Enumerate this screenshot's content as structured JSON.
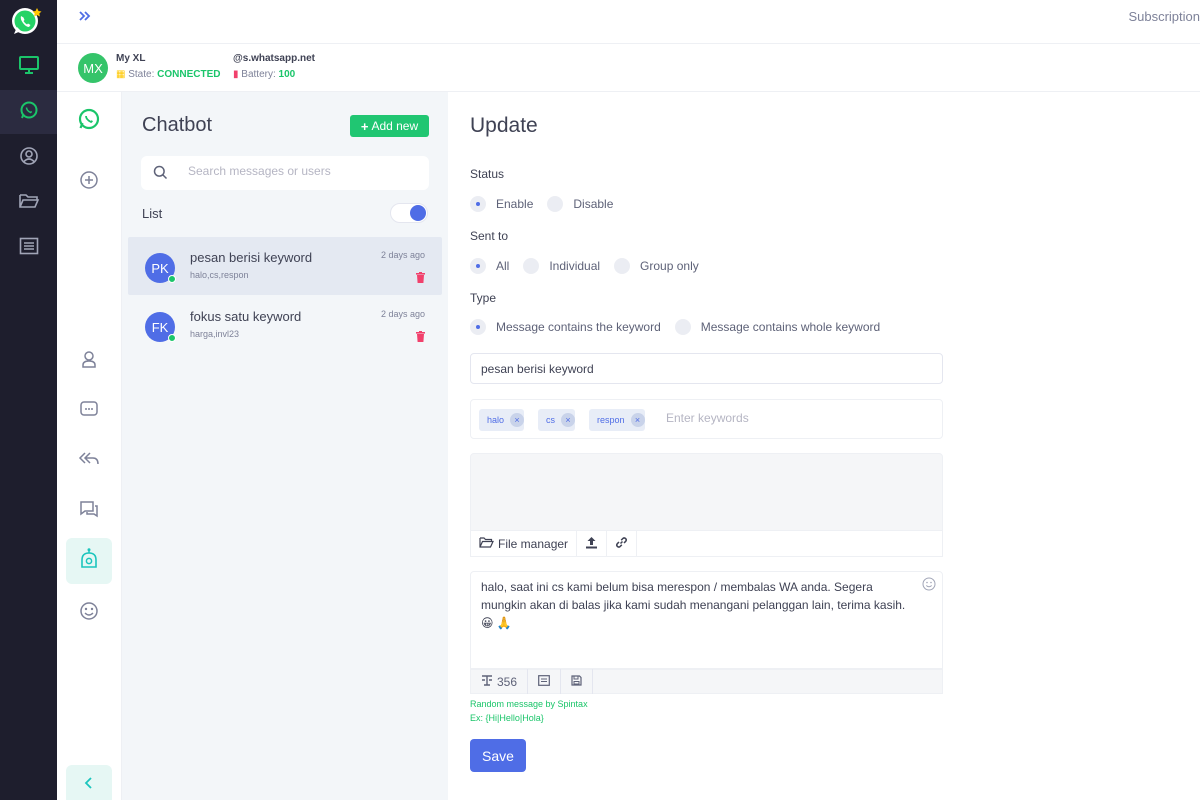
{
  "topbar": {
    "subscription": "Subscription"
  },
  "account": {
    "initials": "MX",
    "name": "My XL",
    "state_label": "State:",
    "state_value": "CONNECTED",
    "number": "@s.whatsapp.net",
    "battery_label": "Battery:",
    "battery_value": "100"
  },
  "rail": {
    "items": [
      "monitor-icon",
      "whatsapp-icon",
      "user-circle-icon",
      "folder-icon",
      "list-icon"
    ]
  },
  "sidebar2": {
    "items": [
      "whatsapp-icon",
      "add-circle-icon",
      "contact-icon",
      "chat-bubble-icon",
      "reply-all-icon",
      "conversation-icon",
      "chatbot-icon",
      "emoji-icon"
    ]
  },
  "list_panel": {
    "title": "Chatbot",
    "add_label": "Add new",
    "search_placeholder": "Search messages or users",
    "list_label": "List",
    "items": [
      {
        "initials": "PK",
        "title": "pesan berisi keyword",
        "keywords": "halo,cs,respon",
        "date": "2 days ago"
      },
      {
        "initials": "FK",
        "title": "fokus satu keyword",
        "keywords": "harga,invl23",
        "date": "2 days ago"
      }
    ]
  },
  "form": {
    "title": "Update",
    "status_label": "Status",
    "status_options": [
      "Enable",
      "Disable"
    ],
    "status_selected": "Enable",
    "sent_to_label": "Sent to",
    "sent_to_options": [
      "All",
      "Individual",
      "Group only"
    ],
    "sent_to_selected": "All",
    "type_label": "Type",
    "type_options": [
      "Message contains the keyword",
      "Message contains whole keyword"
    ],
    "type_selected": "Message contains the keyword",
    "name_value": "pesan berisi keyword",
    "keywords": [
      "halo",
      "cs",
      "respon"
    ],
    "keywords_placeholder": "Enter keywords",
    "file_manager_label": "File manager",
    "message": "halo, saat ini cs kami belum bisa merespon / membalas WA anda. Segera mungkin akan di balas jika kami sudah menangani pelanggan lain, terima kasih. 😀 🙏",
    "char_count": "356",
    "hint_line1": "Random message by Spintax",
    "hint_line2": "Ex: {Hi|Hello|Hola}",
    "save_label": "Save"
  },
  "colors": {
    "rail_bg": "#1e1e2d",
    "accent_blue": "#4f6de6",
    "accent_green": "#1bc56a",
    "delete_red": "#f1416c"
  }
}
